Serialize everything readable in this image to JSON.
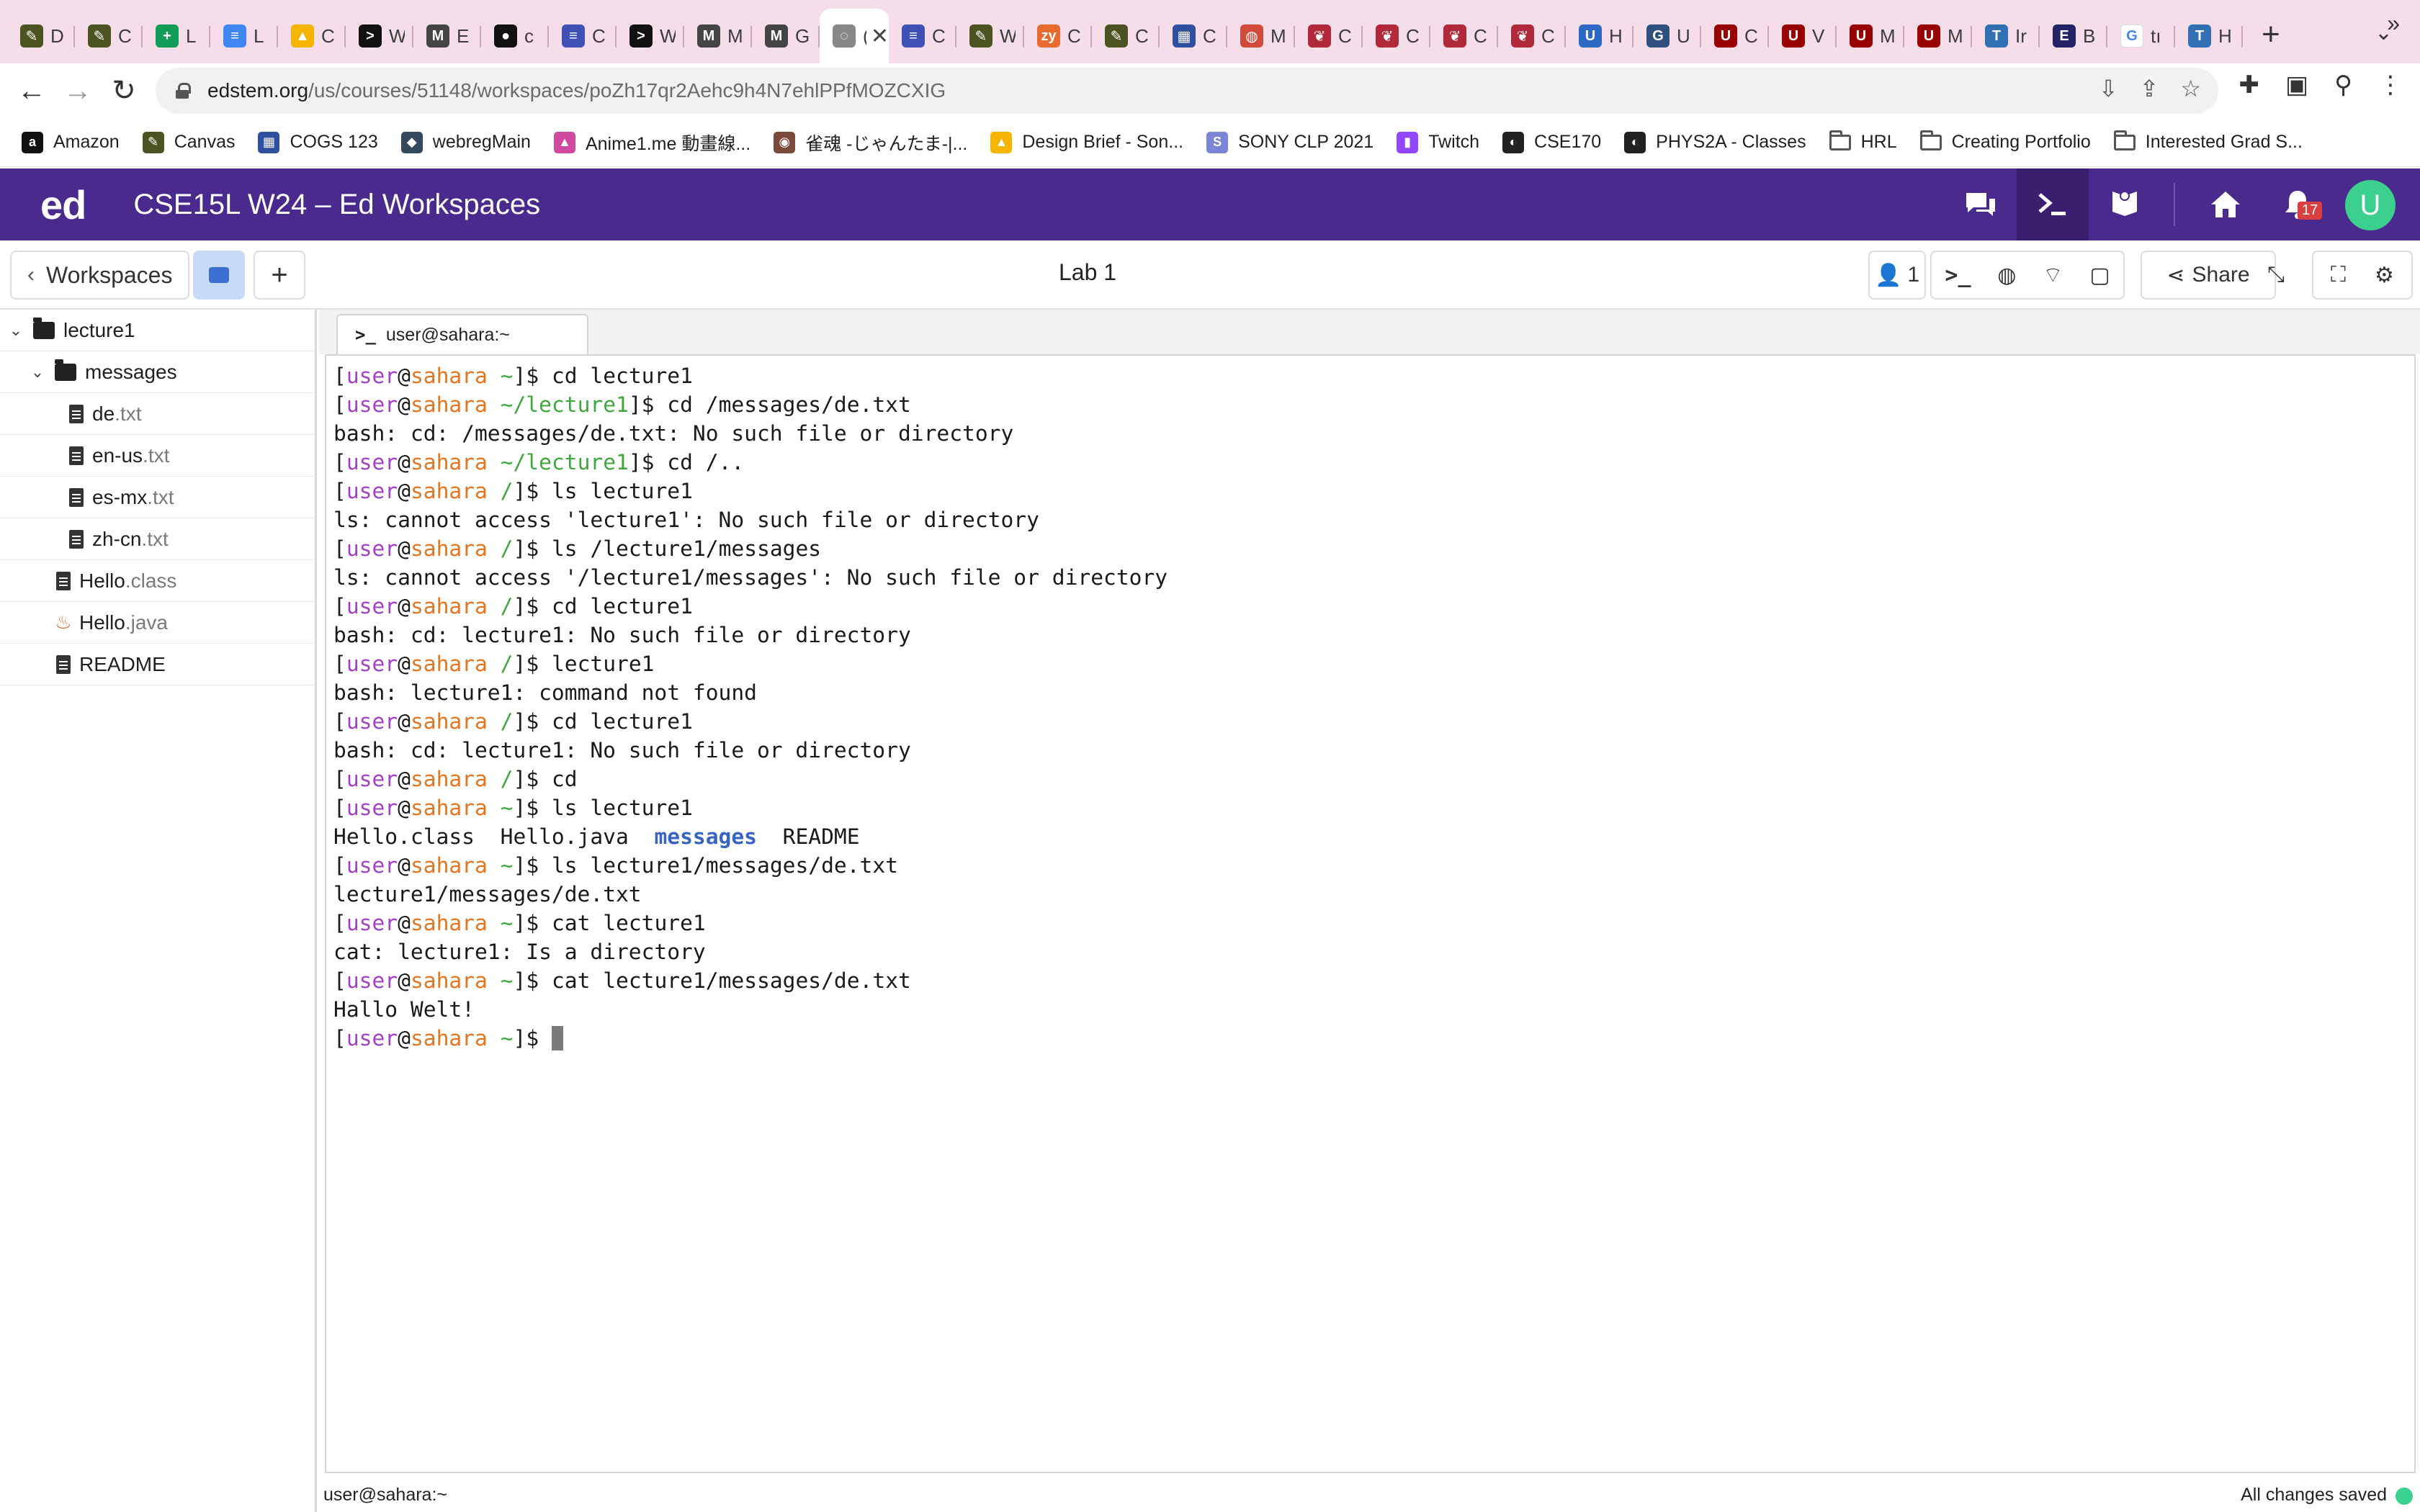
{
  "browser": {
    "tabs": [
      {
        "icon": "canvas-icon",
        "title": "D",
        "color": "#4b5320",
        "glyph": "✎"
      },
      {
        "icon": "canvas-icon",
        "title": "C",
        "color": "#4b5320",
        "glyph": "✎"
      },
      {
        "icon": "sheets-icon",
        "title": "L",
        "color": "#0f9d58",
        "glyph": "+"
      },
      {
        "icon": "docs-icon",
        "title": "L",
        "color": "#4285f4",
        "glyph": "≡"
      },
      {
        "icon": "drive-icon",
        "title": "C",
        "color": "#f4b400",
        "glyph": "▲"
      },
      {
        "icon": "terminal-icon",
        "title": "W",
        "color": "#111111",
        "glyph": ">"
      },
      {
        "icon": "markdown-icon",
        "title": "E",
        "color": "#444444",
        "glyph": "M"
      },
      {
        "icon": "github-icon",
        "title": "c",
        "color": "#111111",
        "glyph": "●"
      },
      {
        "icon": "forms-icon",
        "title": "C",
        "color": "#3f51b5",
        "glyph": "≡"
      },
      {
        "icon": "terminal-icon",
        "title": "W",
        "color": "#111111",
        "glyph": ">"
      },
      {
        "icon": "markdown-icon",
        "title": "M",
        "color": "#444444",
        "glyph": "M"
      },
      {
        "icon": "markdown-icon",
        "title": "G",
        "color": "#444444",
        "glyph": "M"
      },
      {
        "icon": "loading-icon",
        "title": "(",
        "color": "#888888",
        "glyph": "◌",
        "active": true
      },
      {
        "icon": "forms-icon",
        "title": "C",
        "color": "#3f51b5",
        "glyph": "≡"
      },
      {
        "icon": "canvas-icon",
        "title": "W",
        "color": "#4b5320",
        "glyph": "✎"
      },
      {
        "icon": "zybooks-icon",
        "title": "C",
        "color": "#e86a2f",
        "glyph": "zy"
      },
      {
        "icon": "canvas-icon",
        "title": "C",
        "color": "#4b5320",
        "glyph": "✎"
      },
      {
        "icon": "calendar-icon",
        "title": "C",
        "color": "#2f4f9f",
        "glyph": "▦"
      },
      {
        "icon": "shield-icon",
        "title": "M",
        "color": "#d14a3a",
        "glyph": "◍"
      },
      {
        "icon": "pin-icon",
        "title": "C",
        "color": "#b0283a",
        "glyph": "❦"
      },
      {
        "icon": "pin-icon",
        "title": "C",
        "color": "#b0283a",
        "glyph": "❦"
      },
      {
        "icon": "pin-icon",
        "title": "C",
        "color": "#b0283a",
        "glyph": "❦"
      },
      {
        "icon": "pin-icon",
        "title": "C",
        "color": "#b0283a",
        "glyph": "❦"
      },
      {
        "icon": "ucla-icon",
        "title": "H",
        "color": "#2d68c4",
        "glyph": "U"
      },
      {
        "icon": "grad-icon",
        "title": "U",
        "color": "#2f4f7f",
        "glyph": "G"
      },
      {
        "icon": "usc-icon",
        "title": "C",
        "color": "#990000",
        "glyph": "U"
      },
      {
        "icon": "usc-icon",
        "title": "V",
        "color": "#990000",
        "glyph": "U"
      },
      {
        "icon": "usc-icon",
        "title": "M",
        "color": "#990000",
        "glyph": "U"
      },
      {
        "icon": "usc-icon",
        "title": "M",
        "color": "#990000",
        "glyph": "U"
      },
      {
        "icon": "tum-icon",
        "title": "Ir",
        "color": "#3070b3",
        "glyph": "T"
      },
      {
        "icon": "e-icon",
        "title": "B",
        "color": "#222266",
        "glyph": "E"
      },
      {
        "icon": "google-icon",
        "title": "tı",
        "color": "#ffffff",
        "glyph": "G"
      },
      {
        "icon": "tum-icon",
        "title": "H",
        "color": "#3070b3",
        "glyph": "T"
      }
    ],
    "active_tab_close": "✕",
    "new_tab": "+",
    "url_host": "edstem.org",
    "url_path": "/us/courses/51148/workspaces/poZh17qr2Aehc9h4N7ehlPPfMOZCXIG",
    "bookmarks": [
      {
        "icon": "amazon-icon",
        "label": "Amazon",
        "color": "#111111",
        "glyph": "a"
      },
      {
        "icon": "canvas-icon",
        "label": "Canvas",
        "color": "#4b5320",
        "glyph": "✎"
      },
      {
        "icon": "calendar-icon",
        "label": "COGS 123",
        "color": "#2f4f9f",
        "glyph": "▦"
      },
      {
        "icon": "fish-icon",
        "label": "webregMain",
        "color": "#34495e",
        "glyph": "◆"
      },
      {
        "icon": "anime-icon",
        "label": "Anime1.me 動畫線...",
        "color": "#d14aa0",
        "glyph": "▲"
      },
      {
        "icon": "mahjong-icon",
        "label": "雀魂 -じゃんたま-|...",
        "color": "#7a4a3a",
        "glyph": "◉"
      },
      {
        "icon": "drive-icon",
        "label": "Design Brief - Son...",
        "color": "#f4b400",
        "glyph": "▲"
      },
      {
        "icon": "sony-icon",
        "label": "SONY CLP 2021",
        "color": "#7b86d8",
        "glyph": "S"
      },
      {
        "icon": "twitch-icon",
        "label": "Twitch",
        "color": "#9146ff",
        "glyph": "▮"
      },
      {
        "icon": "globe-icon",
        "label": "CSE170",
        "color": "#222222",
        "glyph": "◐"
      },
      {
        "icon": "globe-icon",
        "label": "PHYS2A - Classes",
        "color": "#222222",
        "glyph": "◐"
      },
      {
        "icon": "folder-icon",
        "label": "HRL",
        "folder": true
      },
      {
        "icon": "folder-icon",
        "label": "Creating Portfolio",
        "folder": true
      },
      {
        "icon": "folder-icon",
        "label": "Interested Grad S...",
        "folder": true
      }
    ],
    "bookmarks_more": "»"
  },
  "ed": {
    "logo": "ed",
    "title": "CSE15L W24 – Ed Workspaces",
    "notification_count": "17",
    "avatar_letter": "U"
  },
  "workspace": {
    "back_label": "Workspaces",
    "title": "Lab 1",
    "users_count": "1",
    "share_label": "Share"
  },
  "filetree": [
    {
      "name": "lecture1",
      "ext": "",
      "type": "folder",
      "level": 0,
      "expanded": true
    },
    {
      "name": "messages",
      "ext": "",
      "type": "folder",
      "level": 1,
      "expanded": true
    },
    {
      "name": "de",
      "ext": ".txt",
      "type": "file",
      "level": 2
    },
    {
      "name": "en-us",
      "ext": ".txt",
      "type": "file",
      "level": 2
    },
    {
      "name": "es-mx",
      "ext": ".txt",
      "type": "file",
      "level": 2
    },
    {
      "name": "zh-cn",
      "ext": ".txt",
      "type": "file",
      "level": 2
    },
    {
      "name": "Hello",
      "ext": ".class",
      "type": "file",
      "level": 1
    },
    {
      "name": "Hello",
      "ext": ".java",
      "type": "java",
      "level": 1
    },
    {
      "name": "README",
      "ext": "",
      "type": "file",
      "level": 1
    }
  ],
  "terminal": {
    "tab_label": "user@sahara:~",
    "user": "user",
    "host": "sahara",
    "lines": [
      {
        "dir": "~",
        "cmd": "cd lecture1"
      },
      {
        "dir": "~/lecture1",
        "cmd": "cd /messages/de.txt"
      },
      {
        "out": "bash: cd: /messages/de.txt: No such file or directory"
      },
      {
        "dir": "~/lecture1",
        "cmd": "cd /.."
      },
      {
        "dir": "/",
        "cmd": "ls lecture1"
      },
      {
        "out": "ls: cannot access 'lecture1': No such file or directory"
      },
      {
        "dir": "/",
        "cmd": "ls /lecture1/messages"
      },
      {
        "out": "ls: cannot access '/lecture1/messages': No such file or directory"
      },
      {
        "dir": "/",
        "cmd": "cd lecture1"
      },
      {
        "out": "bash: cd: lecture1: No such file or directory"
      },
      {
        "dir": "/",
        "cmd": "lecture1"
      },
      {
        "out": "bash: lecture1: command not found"
      },
      {
        "dir": "/",
        "cmd": "cd lecture1"
      },
      {
        "out": "bash: cd: lecture1: No such file or directory"
      },
      {
        "dir": "/",
        "cmd": "cd"
      },
      {
        "dir": "~",
        "cmd": "ls lecture1"
      },
      {
        "ls": [
          "Hello.class",
          "Hello.java",
          "messages",
          "README"
        ]
      },
      {
        "dir": "~",
        "cmd": "ls lecture1/messages/de.txt"
      },
      {
        "out": "lecture1/messages/de.txt"
      },
      {
        "dir": "~",
        "cmd": "cat lecture1"
      },
      {
        "out": "cat: lecture1: Is a directory"
      },
      {
        "dir": "~",
        "cmd": "cat lecture1/messages/de.txt"
      },
      {
        "out": "Hallo Welt!"
      },
      {
        "dir": "~",
        "cmd": "",
        "cursor": true
      }
    ]
  },
  "status": {
    "left": "user@sahara:~",
    "right": "All changes saved"
  },
  "colors": {
    "ed_header": "#4b2a8d",
    "prompt_user": "#a240c7",
    "prompt_host": "#e5751f",
    "prompt_dir": "#3fa83b",
    "ls_dir": "#3763c6",
    "saved_dot": "#3bd08e"
  }
}
